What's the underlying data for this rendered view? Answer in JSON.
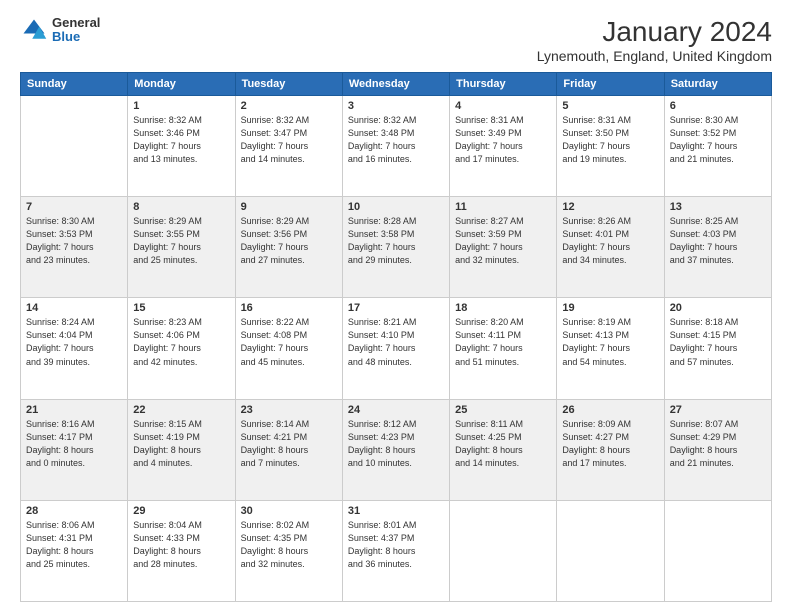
{
  "header": {
    "logo": {
      "general": "General",
      "blue": "Blue"
    },
    "title": "January 2024",
    "subtitle": "Lynemouth, England, United Kingdom"
  },
  "days_of_week": [
    "Sunday",
    "Monday",
    "Tuesday",
    "Wednesday",
    "Thursday",
    "Friday",
    "Saturday"
  ],
  "weeks": [
    [
      {
        "day": "",
        "info": ""
      },
      {
        "day": "1",
        "info": "Sunrise: 8:32 AM\nSunset: 3:46 PM\nDaylight: 7 hours\nand 13 minutes."
      },
      {
        "day": "2",
        "info": "Sunrise: 8:32 AM\nSunset: 3:47 PM\nDaylight: 7 hours\nand 14 minutes."
      },
      {
        "day": "3",
        "info": "Sunrise: 8:32 AM\nSunset: 3:48 PM\nDaylight: 7 hours\nand 16 minutes."
      },
      {
        "day": "4",
        "info": "Sunrise: 8:31 AM\nSunset: 3:49 PM\nDaylight: 7 hours\nand 17 minutes."
      },
      {
        "day": "5",
        "info": "Sunrise: 8:31 AM\nSunset: 3:50 PM\nDaylight: 7 hours\nand 19 minutes."
      },
      {
        "day": "6",
        "info": "Sunrise: 8:30 AM\nSunset: 3:52 PM\nDaylight: 7 hours\nand 21 minutes."
      }
    ],
    [
      {
        "day": "7",
        "info": "Sunrise: 8:30 AM\nSunset: 3:53 PM\nDaylight: 7 hours\nand 23 minutes."
      },
      {
        "day": "8",
        "info": "Sunrise: 8:29 AM\nSunset: 3:55 PM\nDaylight: 7 hours\nand 25 minutes."
      },
      {
        "day": "9",
        "info": "Sunrise: 8:29 AM\nSunset: 3:56 PM\nDaylight: 7 hours\nand 27 minutes."
      },
      {
        "day": "10",
        "info": "Sunrise: 8:28 AM\nSunset: 3:58 PM\nDaylight: 7 hours\nand 29 minutes."
      },
      {
        "day": "11",
        "info": "Sunrise: 8:27 AM\nSunset: 3:59 PM\nDaylight: 7 hours\nand 32 minutes."
      },
      {
        "day": "12",
        "info": "Sunrise: 8:26 AM\nSunset: 4:01 PM\nDaylight: 7 hours\nand 34 minutes."
      },
      {
        "day": "13",
        "info": "Sunrise: 8:25 AM\nSunset: 4:03 PM\nDaylight: 7 hours\nand 37 minutes."
      }
    ],
    [
      {
        "day": "14",
        "info": "Sunrise: 8:24 AM\nSunset: 4:04 PM\nDaylight: 7 hours\nand 39 minutes."
      },
      {
        "day": "15",
        "info": "Sunrise: 8:23 AM\nSunset: 4:06 PM\nDaylight: 7 hours\nand 42 minutes."
      },
      {
        "day": "16",
        "info": "Sunrise: 8:22 AM\nSunset: 4:08 PM\nDaylight: 7 hours\nand 45 minutes."
      },
      {
        "day": "17",
        "info": "Sunrise: 8:21 AM\nSunset: 4:10 PM\nDaylight: 7 hours\nand 48 minutes."
      },
      {
        "day": "18",
        "info": "Sunrise: 8:20 AM\nSunset: 4:11 PM\nDaylight: 7 hours\nand 51 minutes."
      },
      {
        "day": "19",
        "info": "Sunrise: 8:19 AM\nSunset: 4:13 PM\nDaylight: 7 hours\nand 54 minutes."
      },
      {
        "day": "20",
        "info": "Sunrise: 8:18 AM\nSunset: 4:15 PM\nDaylight: 7 hours\nand 57 minutes."
      }
    ],
    [
      {
        "day": "21",
        "info": "Sunrise: 8:16 AM\nSunset: 4:17 PM\nDaylight: 8 hours\nand 0 minutes."
      },
      {
        "day": "22",
        "info": "Sunrise: 8:15 AM\nSunset: 4:19 PM\nDaylight: 8 hours\nand 4 minutes."
      },
      {
        "day": "23",
        "info": "Sunrise: 8:14 AM\nSunset: 4:21 PM\nDaylight: 8 hours\nand 7 minutes."
      },
      {
        "day": "24",
        "info": "Sunrise: 8:12 AM\nSunset: 4:23 PM\nDaylight: 8 hours\nand 10 minutes."
      },
      {
        "day": "25",
        "info": "Sunrise: 8:11 AM\nSunset: 4:25 PM\nDaylight: 8 hours\nand 14 minutes."
      },
      {
        "day": "26",
        "info": "Sunrise: 8:09 AM\nSunset: 4:27 PM\nDaylight: 8 hours\nand 17 minutes."
      },
      {
        "day": "27",
        "info": "Sunrise: 8:07 AM\nSunset: 4:29 PM\nDaylight: 8 hours\nand 21 minutes."
      }
    ],
    [
      {
        "day": "28",
        "info": "Sunrise: 8:06 AM\nSunset: 4:31 PM\nDaylight: 8 hours\nand 25 minutes."
      },
      {
        "day": "29",
        "info": "Sunrise: 8:04 AM\nSunset: 4:33 PM\nDaylight: 8 hours\nand 28 minutes."
      },
      {
        "day": "30",
        "info": "Sunrise: 8:02 AM\nSunset: 4:35 PM\nDaylight: 8 hours\nand 32 minutes."
      },
      {
        "day": "31",
        "info": "Sunrise: 8:01 AM\nSunset: 4:37 PM\nDaylight: 8 hours\nand 36 minutes."
      },
      {
        "day": "",
        "info": ""
      },
      {
        "day": "",
        "info": ""
      },
      {
        "day": "",
        "info": ""
      }
    ]
  ]
}
